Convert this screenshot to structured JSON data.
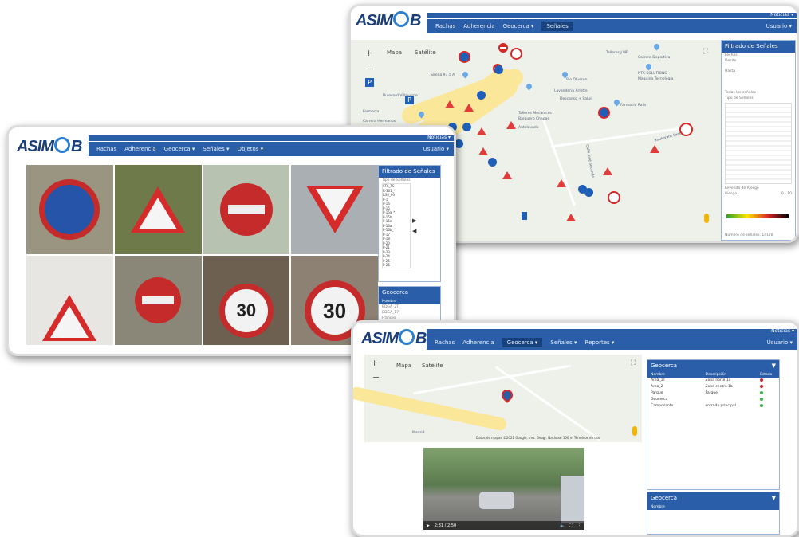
{
  "brand": {
    "name_left": "ASIM",
    "name_right": "B"
  },
  "colors": {
    "nav": "#2a5ea8",
    "sign_red": "#d62828",
    "sign_blue": "#1f5fb8",
    "road": "#fbe79a"
  },
  "window_map": {
    "nav": [
      "Rachas",
      "Adherencia",
      "Geocerca ▾",
      "Señales"
    ],
    "util_top": "Noticias ▾",
    "util_user": "Usuario ▾",
    "map_tabs": [
      "Mapa",
      "Satélite"
    ],
    "map_labels": [
      "Talleres J MP",
      "Carrera Deportiva",
      "NTS SOLUTIONS",
      "Maquina Tecnología",
      "Rio Olusson",
      "Lavanderia Arlette",
      "Descanso + Salud",
      "Talleres Mecánicos",
      "Barquero Chapas",
      "Farmacia Rafa",
      "Autolavado",
      "Bulevard Villaverde",
      "Sirena 93.5 A",
      "Carrera Hermanos",
      "Farmacia",
      "Boulevard Santa Eva Y",
      "Calle José Secundo"
    ],
    "filter_panel": {
      "title": "Filtrado de Señales",
      "fields": [
        "Fechas",
        "Desde",
        "Hasta"
      ],
      "checkbox": "Todas las señales",
      "list_title": "Tipo de Señales",
      "legend_title": "Leyenda de Riesgo",
      "legend_min": "Riesgo",
      "legend_max": "0 - 10",
      "count_label": "Número de señales: 14178"
    }
  },
  "window_signals": {
    "nav": [
      "Rachas",
      "Adherencia",
      "Geocerca ▾",
      "Señales ▾",
      "Objetos ▾"
    ],
    "util_top": "Noticias ▾",
    "util_user": "Usuario ▾",
    "thumbnails": [
      "prohibido-estacionar",
      "niños",
      "dirección-prohibida",
      "ceda-el-paso",
      "resalto",
      "dirección-prohibida",
      "velocidad-30",
      "velocidad-30"
    ],
    "speed_value": "30",
    "filter_panel": {
      "title": "Filtrado de Señales",
      "list_title": "Tipo de Señales",
      "items": [
        "STC_TS",
        "R-301_*",
        "R30_60",
        "P-1",
        "P-1a",
        "P-15",
        "P-15a_*",
        "P-15b",
        "P-15c",
        "P-16a",
        "P-16b_*",
        "P-17",
        "P-18",
        "P-20",
        "P-21",
        "P-23",
        "P-24",
        "P-25",
        "P-26"
      ],
      "geocerca_title": "Geocerca",
      "geocerca_header": "Nombre",
      "geocerca_items": [
        "BDGA_2T",
        "BDGA_17",
        "Frances"
      ]
    }
  },
  "window_geofence": {
    "nav": [
      "Rachas",
      "Adherencia",
      "Geocerca ▾",
      "Señales ▾",
      "Reportes ▾"
    ],
    "util_top": "Noticias ▾",
    "util_user": "Usuario ▾",
    "map_tabs": [
      "Mapa",
      "Satélite"
    ],
    "map_footer": "Datos de mapas ©2021 Google, Inst. Geogr. Nacional  100 m  Términos de uso",
    "map_label": "Madrid",
    "video_time": "2:31 / 2:50",
    "panel1": {
      "title": "Geocerca",
      "filter": "▼",
      "columns": [
        "Nombre",
        "Descripción",
        "Estado"
      ],
      "rows": [
        {
          "name": "Area_1T",
          "desc": "Zona norte 1a",
          "status": "red"
        },
        {
          "name": "Area_2",
          "desc": "Zona centro 1b",
          "status": "red"
        },
        {
          "name": "Parque",
          "desc": "Parque",
          "status": "green"
        },
        {
          "name": "Geocerca",
          "desc": "",
          "status": "green"
        },
        {
          "name": "Camposanto",
          "desc": "entrada principal",
          "status": "green"
        }
      ]
    },
    "panel2": {
      "title": "Geocerca",
      "filter": "▼",
      "columns": [
        "Nombre"
      ]
    }
  }
}
